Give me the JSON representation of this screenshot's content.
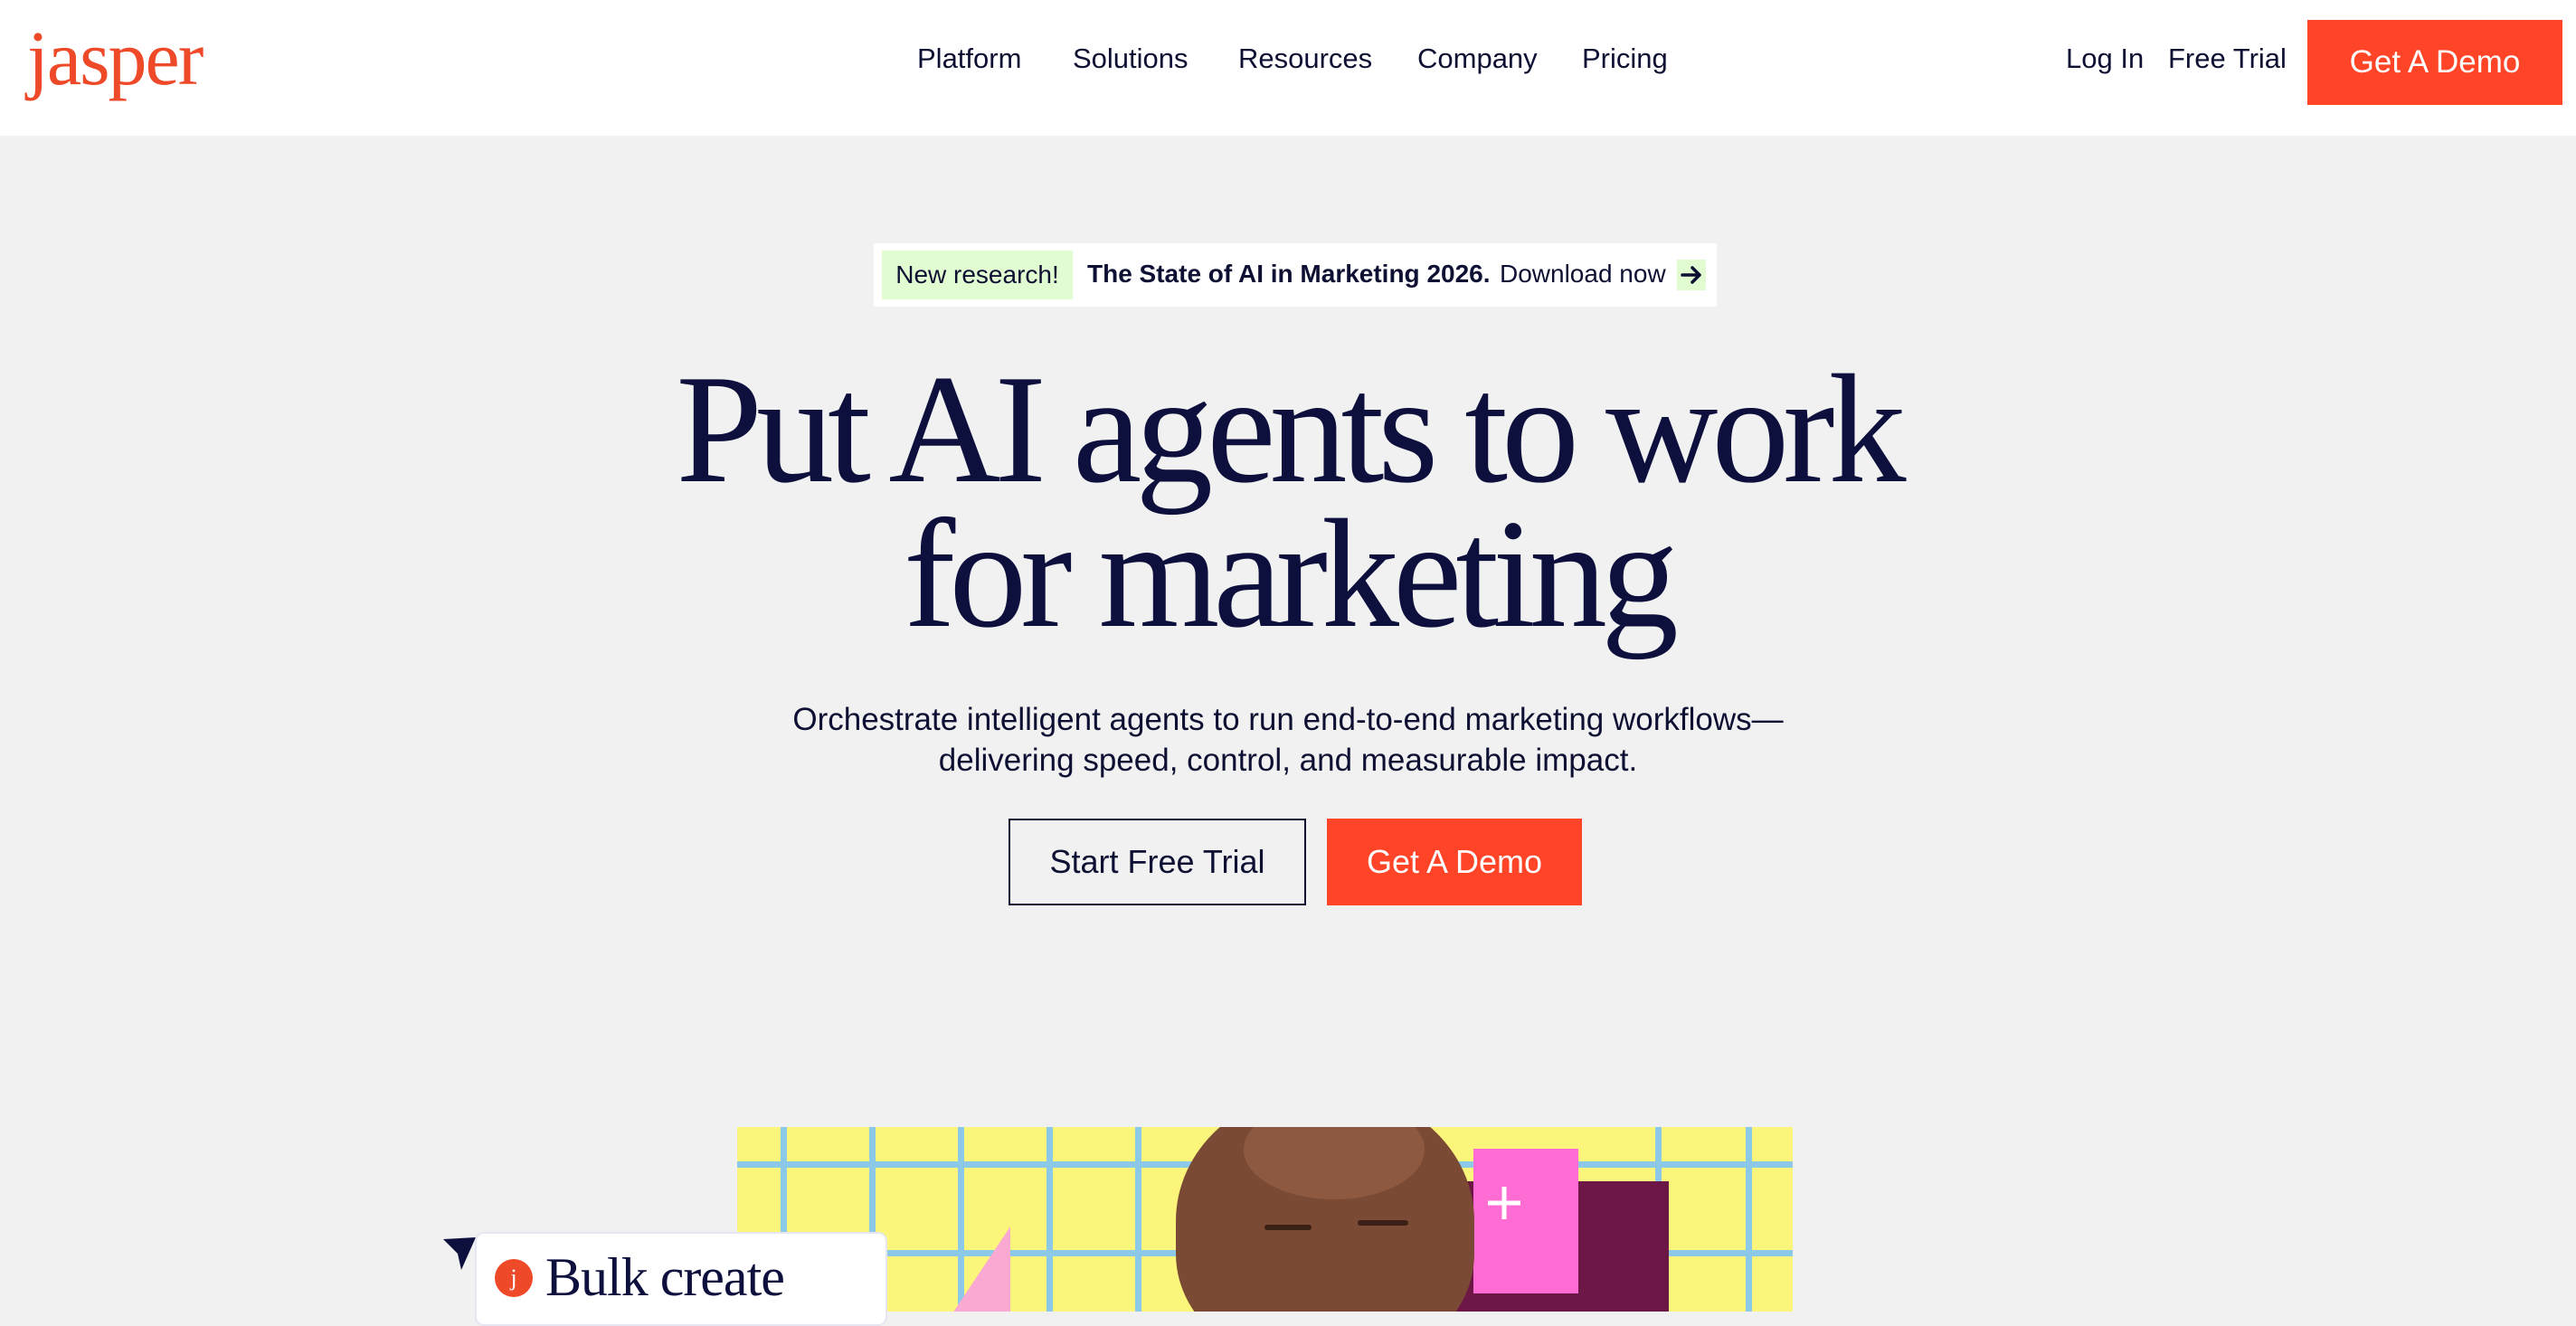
{
  "header": {
    "logo": "jasper",
    "nav": [
      "Platform",
      "Solutions",
      "Resources",
      "Company",
      "Pricing"
    ],
    "login": "Log In",
    "free_trial": "Free Trial",
    "demo": "Get A Demo"
  },
  "banner": {
    "badge": "New research!",
    "title": "The State of AI in Marketing 2026.",
    "link": "Download now",
    "icon": "arrow-right-icon"
  },
  "hero": {
    "title_line1": "Put AI agents to work",
    "title_line2": "for marketing",
    "subtitle_line1": "Orchestrate intelligent agents to run end-to-end marketing workflows—",
    "subtitle_line2": "delivering speed, control, and measurable impact.",
    "cta_primary": "Start Free Trial",
    "cta_secondary": "Get A Demo"
  },
  "illustration": {
    "card_icon_letter": "j",
    "card_label": "Bulk create"
  },
  "colors": {
    "accent": "#ff4427",
    "brand": "#ee4a2a",
    "ink": "#0d1033",
    "badge_bg": "#e2fcd2",
    "hero_bg": "#f1f1f1"
  }
}
